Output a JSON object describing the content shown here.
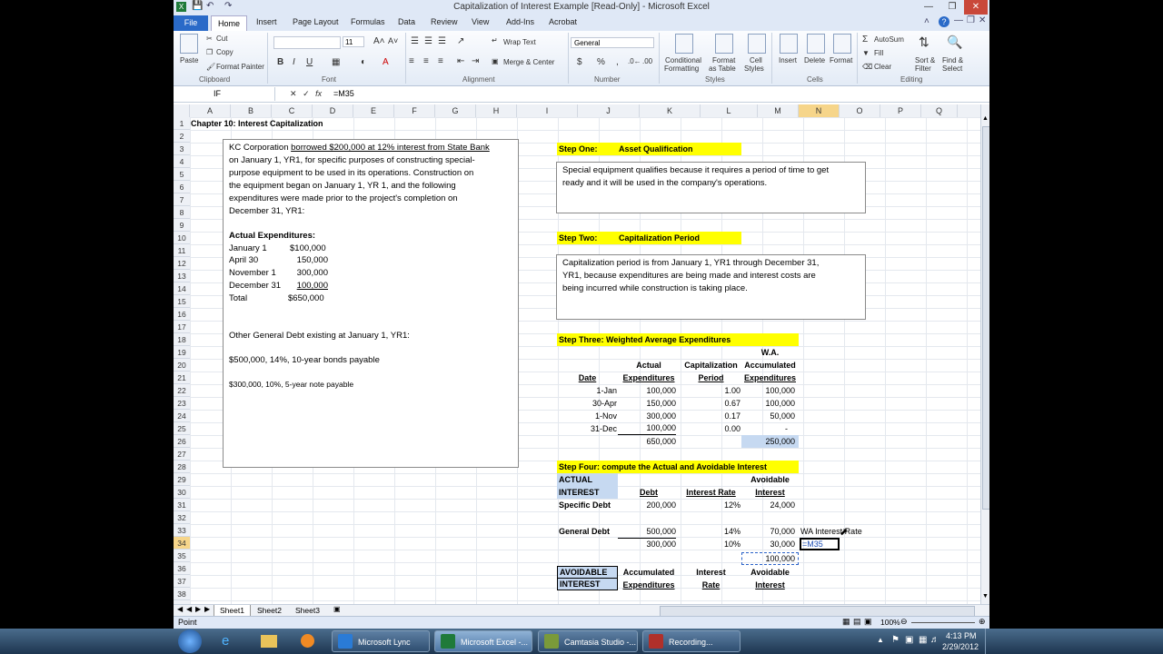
{
  "window": {
    "title": "Capitalization of Interest Example  [Read-Only]  -  Microsoft Excel"
  },
  "ribbon": {
    "file_tab": "File",
    "tabs": [
      "Home",
      "Insert",
      "Page Layout",
      "Formulas",
      "Data",
      "Review",
      "View",
      "Add-Ins",
      "Acrobat"
    ],
    "paste": "Paste",
    "cut": "Cut",
    "copy": "Copy",
    "format_painter": "Format Painter",
    "font_size": "11",
    "wrap_text": "Wrap Text",
    "merge_center": "Merge & Center",
    "number_format": "General",
    "currency": "$",
    "percent": "%",
    "comma": ",",
    "cond_fmt_1": "Conditional",
    "cond_fmt_2": "Formatting",
    "fmt_table_1": "Format",
    "fmt_table_2": "as Table",
    "cell_styles_1": "Cell",
    "cell_styles_2": "Styles",
    "insert": "Insert",
    "delete": "Delete",
    "format": "Format",
    "autosum": "AutoSum",
    "fill": "Fill",
    "clear": "Clear",
    "sort_1": "Sort &",
    "sort_2": "Filter",
    "find_1": "Find &",
    "find_2": "Select",
    "groups": {
      "clipboard": "Clipboard",
      "font": "Font",
      "alignment": "Alignment",
      "number": "Number",
      "styles": "Styles",
      "cells": "Cells",
      "editing": "Editing"
    }
  },
  "formula_bar": {
    "name_box": "IF",
    "formula": "=M35"
  },
  "columns": [
    "A",
    "B",
    "C",
    "D",
    "E",
    "F",
    "G",
    "H",
    "I",
    "J",
    "K",
    "L",
    "M",
    "N",
    "O",
    "P",
    "Q"
  ],
  "rows": [
    "1",
    "2",
    "3",
    "4",
    "5",
    "6",
    "7",
    "8",
    "9",
    "10",
    "11",
    "12",
    "13",
    "14",
    "15",
    "16",
    "17",
    "18",
    "19",
    "20",
    "21",
    "22",
    "23",
    "24",
    "25",
    "26",
    "27",
    "28",
    "29",
    "30",
    "31",
    "32",
    "33",
    "34",
    "35",
    "36",
    "37",
    "38"
  ],
  "sheet": {
    "title": "Chapter 10:  Interest Capitalization",
    "problem": {
      "line1_a": "KC Corporation ",
      "line1_b": "borrowed  $200,000 at 12% interest from State Bank",
      "lines": [
        "on January 1, YR1, for specific purposes of constructing special-",
        "purpose equipment to be used in its operations.  Construction on",
        "the equipment began on January 1, YR 1, and the following",
        "expenditures were made prior to the project's completion on",
        "December 31, YR1:"
      ],
      "actual_heading": "Actual Expenditures:",
      "expenditures": [
        {
          "date": "January 1",
          "amount": "$100,000"
        },
        {
          "date": "April 30",
          "amount": "150,000"
        },
        {
          "date": "November 1",
          "amount": "300,000"
        },
        {
          "date": "December 31",
          "amount": "100,000"
        },
        {
          "date": "Total",
          "amount": "$650,000"
        }
      ],
      "other_debt": "Other General Debt existing at January 1, YR1:",
      "debt1": "$500,000, 14%, 10-year bonds payable",
      "debt2": "$300,000,  10%, 5-year note payable"
    },
    "step1": {
      "label": "Step One:",
      "title": "Asset Qualification",
      "text": [
        "Special equipment qualifies because it requires a period of time to get",
        "ready and it will be used in the company's operations."
      ]
    },
    "step2": {
      "label": "Step Two:",
      "title": "Capitalization Period",
      "text": [
        "Capitalization period is from January 1, YR1 through December 31,",
        "YR1, because expenditures are being made and interest costs are",
        "being incurred while construction is taking place."
      ]
    },
    "step3": {
      "label": "Step Three:  Weighted Average Expenditures",
      "headers": {
        "wa": "W.A.",
        "actual": "Actual",
        "cap": "Capitalization",
        "accum": "Accumulated",
        "date": "Date",
        "expend": "Expenditures",
        "period": "Period",
        "expend2": "Expenditures"
      },
      "rows": [
        {
          "date": "1-Jan",
          "actual": "100,000",
          "period": "1.00",
          "wa": "100,000"
        },
        {
          "date": "30-Apr",
          "actual": "150,000",
          "period": "0.67",
          "wa": "100,000"
        },
        {
          "date": "1-Nov",
          "actual": "300,000",
          "period": "0.17",
          "wa": "50,000"
        },
        {
          "date": "31-Dec",
          "actual": "100,000",
          "period": "0.00",
          "wa": "-"
        }
      ],
      "total_actual": "650,000",
      "total_wa": "250,000"
    },
    "step4": {
      "label": "Step Four:  compute the Actual and Avoidable Interest",
      "actual": "ACTUAL",
      "interest": "INTEREST",
      "avoidable": "Avoidable",
      "interest2": "Interest",
      "debt": "Debt",
      "rate": "Interest Rate",
      "specific_label": "Specific Debt",
      "specific_debt": "200,000",
      "specific_rate": "12%",
      "specific_int": "24,000",
      "general_label": "General Debt",
      "g1_debt": "500,000",
      "g1_rate": "14%",
      "g1_int": "70,000",
      "g2_debt": "300,000",
      "g2_rate": "10%",
      "g2_int": "30,000",
      "g_total": "100,000",
      "wa_rate_label": "WA Interest Rate",
      "edit_cell": "=M35",
      "avoidable_hdr1": "AVOIDABLE",
      "avoidable_hdr2": "INTEREST",
      "accum1": "Accumulated",
      "accum2": "Expenditures",
      "irate1": "Interest",
      "irate2": "Rate",
      "avoid1": "Avoidable",
      "avoid2": "Interest"
    }
  },
  "sheet_tabs": [
    "Sheet1",
    "Sheet2",
    "Sheet3"
  ],
  "status": {
    "mode": "Point",
    "zoom": "100%"
  },
  "taskbar": {
    "items": [
      "Microsoft Lync",
      "Microsoft Excel -...",
      "Camtasia Studio -...",
      "Recording..."
    ],
    "time": "4:13 PM",
    "date": "2/29/2012"
  }
}
